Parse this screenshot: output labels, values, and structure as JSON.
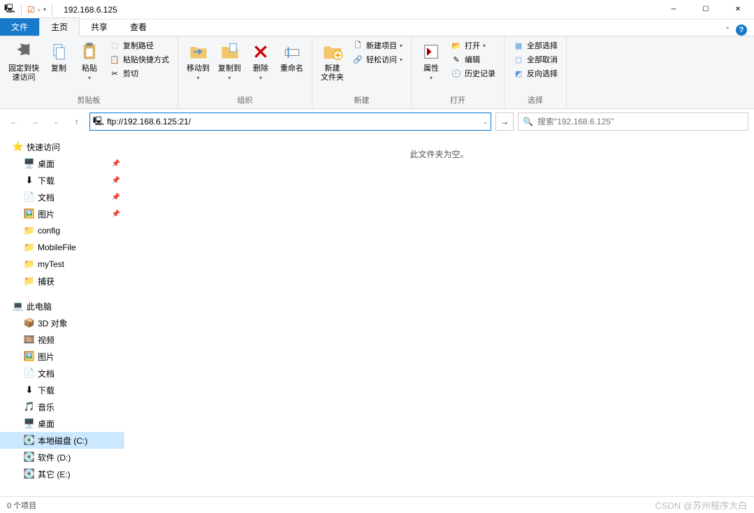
{
  "window": {
    "title": "192.168.6.125"
  },
  "tabs": {
    "file": "文件",
    "home": "主页",
    "share": "共享",
    "view": "查看"
  },
  "ribbon": {
    "clipboard": {
      "pin": "固定到快\n速访问",
      "copy": "复制",
      "paste": "粘贴",
      "copypath": "复制路径",
      "pasteshortcut": "粘贴快捷方式",
      "cut": "剪切",
      "label": "剪贴板"
    },
    "organize": {
      "moveto": "移动到",
      "copyto": "复制到",
      "delete": "删除",
      "rename": "重命名",
      "label": "组织"
    },
    "new": {
      "newfolder": "新建\n文件夹",
      "newitem": "新建项目",
      "easyaccess": "轻松访问",
      "label": "新建"
    },
    "open": {
      "props": "属性",
      "open": "打开",
      "edit": "编辑",
      "history": "历史记录",
      "label": "打开"
    },
    "select": {
      "all": "全部选择",
      "none": "全部取消",
      "invert": "反向选择",
      "label": "选择"
    }
  },
  "address": {
    "value": "ftp://192.168.6.125:21/"
  },
  "search": {
    "placeholder": "搜索\"192.168.6.125\""
  },
  "emptytext": "此文件夹为空。",
  "tree": {
    "quick": "快速访问",
    "items1": [
      {
        "label": "桌面",
        "icon": "🖥️"
      },
      {
        "label": "下载",
        "icon": "⬇"
      },
      {
        "label": "文档",
        "icon": "📄"
      },
      {
        "label": "图片",
        "icon": "🖼️"
      },
      {
        "label": "config",
        "icon": "📁"
      },
      {
        "label": "MobileFile",
        "icon": "📁"
      },
      {
        "label": "myTest",
        "icon": "📁"
      },
      {
        "label": "捕获",
        "icon": "📁"
      }
    ],
    "thispc": "此电脑",
    "items2": [
      {
        "label": "3D 对象",
        "icon": "📦"
      },
      {
        "label": "视频",
        "icon": "🎞️"
      },
      {
        "label": "图片",
        "icon": "🖼️"
      },
      {
        "label": "文档",
        "icon": "📄"
      },
      {
        "label": "下载",
        "icon": "⬇"
      },
      {
        "label": "音乐",
        "icon": "🎵"
      },
      {
        "label": "桌面",
        "icon": "🖥️"
      }
    ],
    "drives": [
      {
        "label": "本地磁盘 (C:)",
        "icon": "💽",
        "selected": true
      },
      {
        "label": "软件 (D:)",
        "icon": "💽"
      },
      {
        "label": "其它 (E:)",
        "icon": "💽"
      }
    ]
  },
  "status": {
    "items": "0 个项目",
    "watermark": "CSDN @苏州程序大白"
  }
}
